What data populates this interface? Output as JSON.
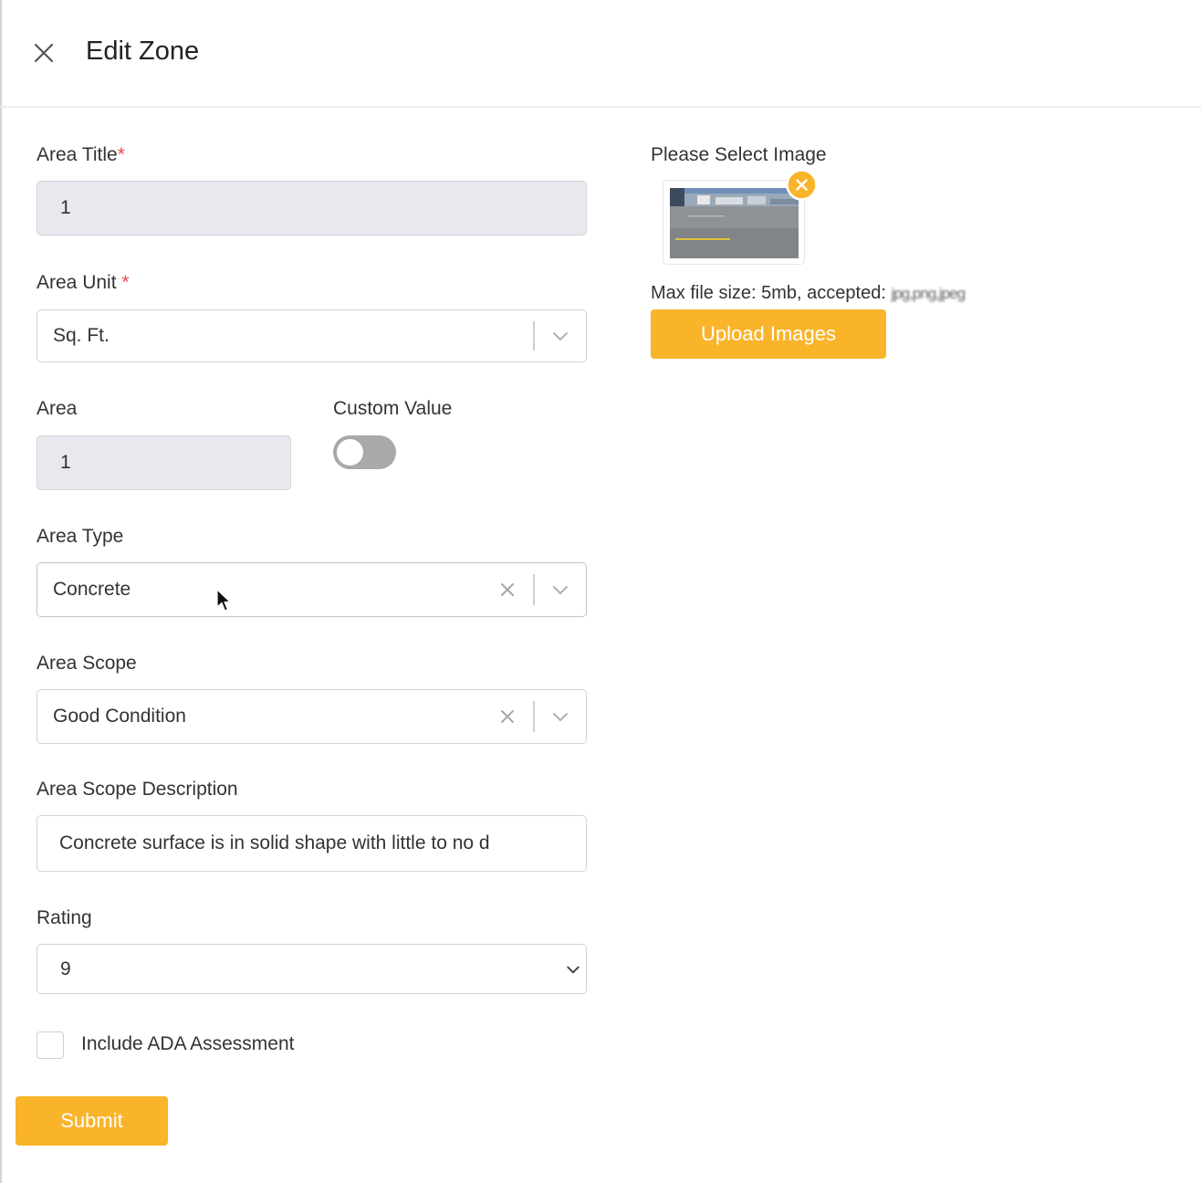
{
  "header": {
    "title": "Edit Zone"
  },
  "form": {
    "area_title": {
      "label": "Area Title",
      "required_mark": "*",
      "value": "1"
    },
    "area_unit": {
      "label": "Area Unit ",
      "required_mark": "*",
      "value": "Sq. Ft."
    },
    "area": {
      "label": "Area",
      "value": "1"
    },
    "custom_value": {
      "label": "Custom Value",
      "enabled": false
    },
    "area_type": {
      "label": "Area Type",
      "value": "Concrete"
    },
    "area_scope": {
      "label": "Area Scope",
      "value": "Good Condition"
    },
    "area_scope_description": {
      "label": "Area Scope Description",
      "value": "Concrete surface is in solid shape with little to no d"
    },
    "rating": {
      "label": "Rating",
      "value": "9"
    },
    "ada": {
      "label": "Include ADA Assessment",
      "checked": false
    },
    "submit_label": "Submit"
  },
  "image_panel": {
    "label": "Please Select Image",
    "info_prefix": "Max file size: 5mb, accepted:",
    "info_blurred": "jpg,png,jpeg",
    "upload_label": "Upload Images"
  },
  "colors": {
    "accent": "#f9b42a",
    "required": "#e5484d",
    "disabled_bg": "#e8e8ee",
    "toggle_off": "#a9a9ac"
  },
  "icons": {
    "close": "close-icon",
    "chevron": "chevron-down-icon",
    "clear": "clear-x-icon",
    "remove": "remove-image-icon"
  }
}
